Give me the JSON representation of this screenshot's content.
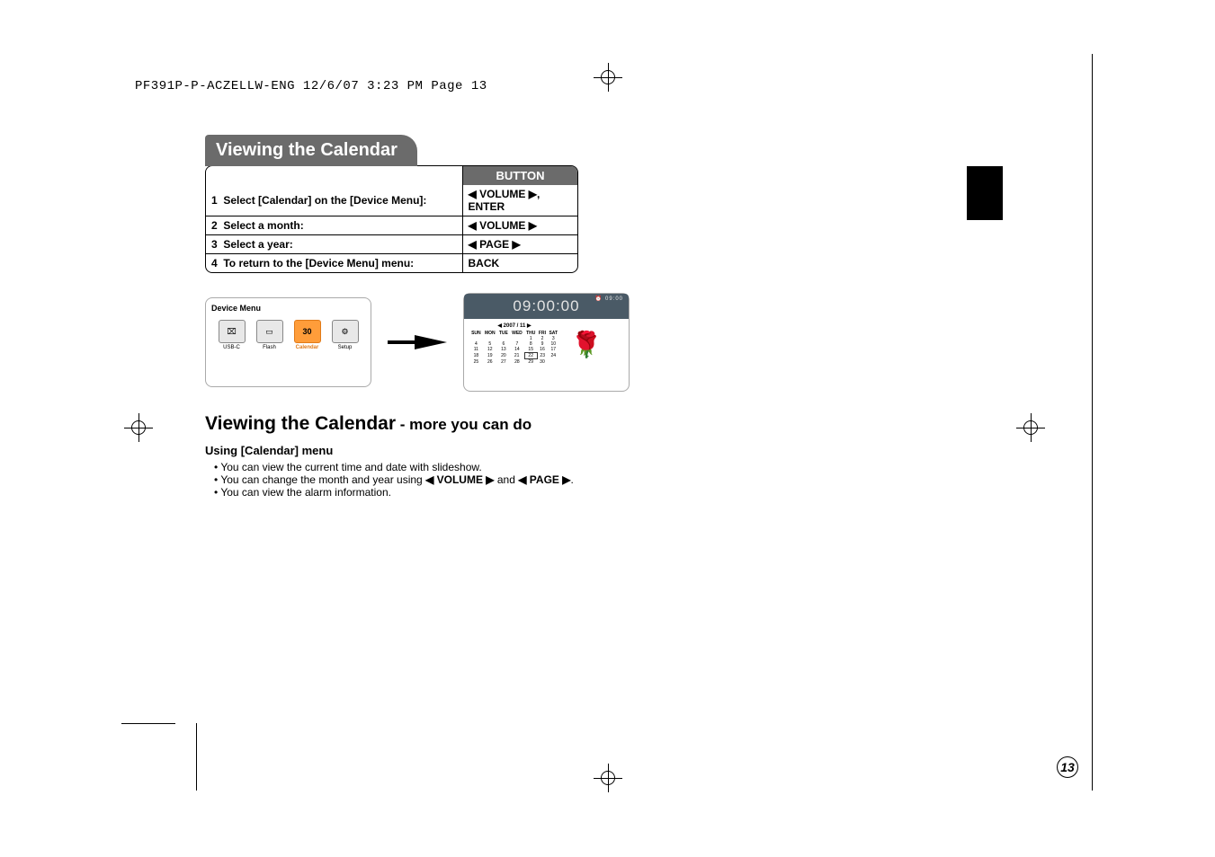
{
  "header_line": "PF391P-P-ACZELLW-ENG  12/6/07  3:23 PM  Page 13",
  "title": "Viewing the Calendar",
  "button_header": "BUTTON",
  "steps": [
    {
      "n": "1",
      "text": "Select [Calendar] on the [Device Menu]:",
      "button_pre": "◀ VOLUME ▶",
      "button_post": ", ENTER"
    },
    {
      "n": "2",
      "text": "Select a month:",
      "button_pre": "◀ VOLUME ▶",
      "button_post": ""
    },
    {
      "n": "3",
      "text": "Select a year:",
      "button_pre": "◀ PAGE ▶",
      "button_post": ""
    },
    {
      "n": "4",
      "text": "To return to the [Device Menu] menu:",
      "button_pre": "BACK",
      "button_post": ""
    }
  ],
  "device_menu": {
    "title": "Device Menu",
    "items": [
      {
        "label": "USB-C",
        "glyph": "⌧"
      },
      {
        "label": "Flash",
        "glyph": "▭"
      },
      {
        "label": "Calendar",
        "glyph": "30",
        "selected": true
      },
      {
        "label": "Setup",
        "glyph": "⚙"
      }
    ]
  },
  "calendar_screen": {
    "time": "09:00:00",
    "alarm": "⏰\n09:00",
    "month_label": "◀ 2007 / 11 ▶",
    "weekdays": [
      "SUN",
      "MON",
      "TUE",
      "WED",
      "THU",
      "FRI",
      "SAT"
    ],
    "rows": [
      [
        "",
        "",
        "",
        "",
        "1",
        "2",
        "3"
      ],
      [
        "4",
        "5",
        "6",
        "7",
        "8",
        "9",
        "10"
      ],
      [
        "11",
        "12",
        "13",
        "14",
        "15",
        "16",
        "17"
      ],
      [
        "18",
        "19",
        "20",
        "21",
        "22",
        "23",
        "24"
      ],
      [
        "25",
        "26",
        "27",
        "28",
        "29",
        "30",
        ""
      ]
    ],
    "highlighted_day": "22",
    "rose": "🌹"
  },
  "subtitle_main": "Viewing the Calendar",
  "subtitle_more": " - more you can do",
  "using_heading": "Using [Calendar] menu",
  "bullets": [
    {
      "pre": "You can view the current time and date with slideshow.",
      "bold1": "",
      "mid": "",
      "bold2": "",
      "post": ""
    },
    {
      "pre": "You can change the month and year using ",
      "bold1": "◀ VOLUME ▶",
      "mid": " and ",
      "bold2": "◀ PAGE ▶",
      "post": "."
    },
    {
      "pre": "You can view the alarm information.",
      "bold1": "",
      "mid": "",
      "bold2": "",
      "post": ""
    }
  ],
  "page_number": "13"
}
